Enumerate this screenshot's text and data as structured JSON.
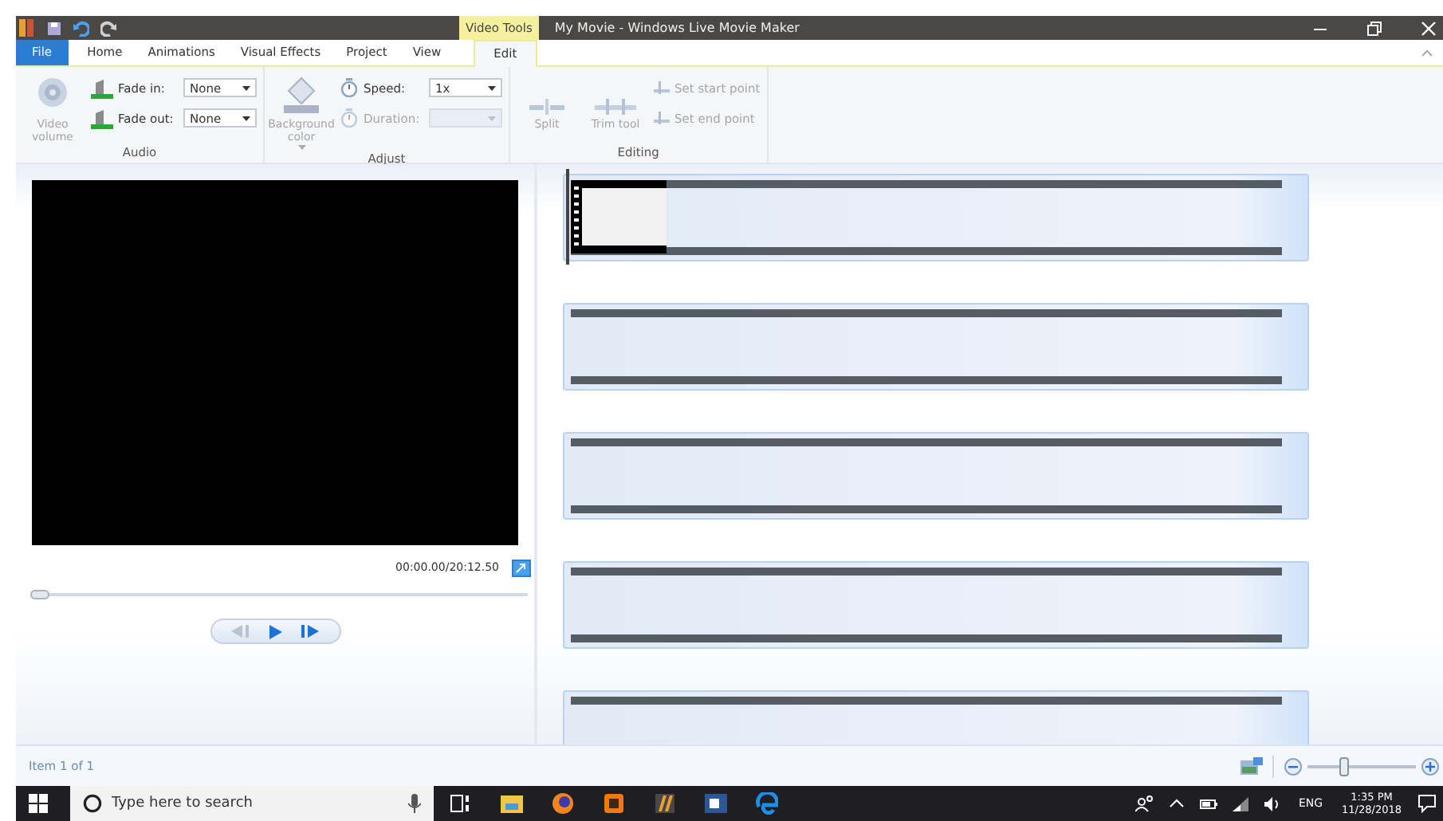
{
  "title_bar": {
    "context_tab": "Video Tools",
    "title": "My Movie - Windows Live Movie Maker"
  },
  "tabs": [
    {
      "label": "File",
      "kind": "file",
      "selected": false
    },
    {
      "label": "Home",
      "kind": "tab",
      "selected": false
    },
    {
      "label": "Animations",
      "kind": "tab",
      "selected": false
    },
    {
      "label": "Visual Effects",
      "kind": "tab",
      "selected": false
    },
    {
      "label": "Project",
      "kind": "tab",
      "selected": false
    },
    {
      "label": "View",
      "kind": "tab",
      "selected": false
    },
    {
      "label": "Edit",
      "kind": "context",
      "selected": true
    }
  ],
  "ribbon": {
    "groups": [
      {
        "label": "Audio",
        "controls": [
          {
            "kind": "big",
            "label": "Video volume",
            "disabled": true
          },
          {
            "kind": "stack",
            "items": [
              {
                "kind": "dropdown",
                "label": "Fade in:",
                "value": "None",
                "disabled": false
              },
              {
                "kind": "dropdown",
                "label": "Fade out:",
                "value": "None",
                "disabled": false
              }
            ]
          }
        ]
      },
      {
        "label": "Adjust",
        "controls": [
          {
            "kind": "big",
            "label": "Background color",
            "caret": true,
            "disabled": true
          },
          {
            "kind": "stack",
            "items": [
              {
                "kind": "dropdown",
                "label": "Speed:",
                "value": "1x",
                "disabled": false
              },
              {
                "kind": "dropdown",
                "label": "Duration:",
                "disabled": true
              }
            ]
          }
        ]
      },
      {
        "label": "Editing",
        "controls": [
          {
            "kind": "big",
            "label": "Split",
            "disabled": true
          },
          {
            "kind": "big",
            "label": "Trim tool",
            "disabled": true
          },
          {
            "kind": "stack",
            "items": [
              {
                "kind": "small",
                "label": "Set start point",
                "disabled": true
              },
              {
                "kind": "small",
                "label": "Set end point",
                "disabled": true
              }
            ]
          }
        ]
      }
    ]
  },
  "preview": {
    "time": "00:00.00/20:12.50",
    "seek": {
      "level": 0
    }
  },
  "storyboard": {
    "clips": [
      {
        "kind": "thumbnail"
      },
      {
        "kind": "blank"
      },
      {
        "kind": "blank"
      },
      {
        "kind": "blank"
      },
      {
        "kind": "blank"
      }
    ]
  },
  "status_bar": {
    "text": "Item 1 of 1",
    "zoom": {
      "level": 0.3
    }
  },
  "taskbar": {
    "search": {
      "placeholder": "Type here to search"
    },
    "language": "ENG",
    "time": "1:35 PM",
    "date": "11/28/2018"
  }
}
